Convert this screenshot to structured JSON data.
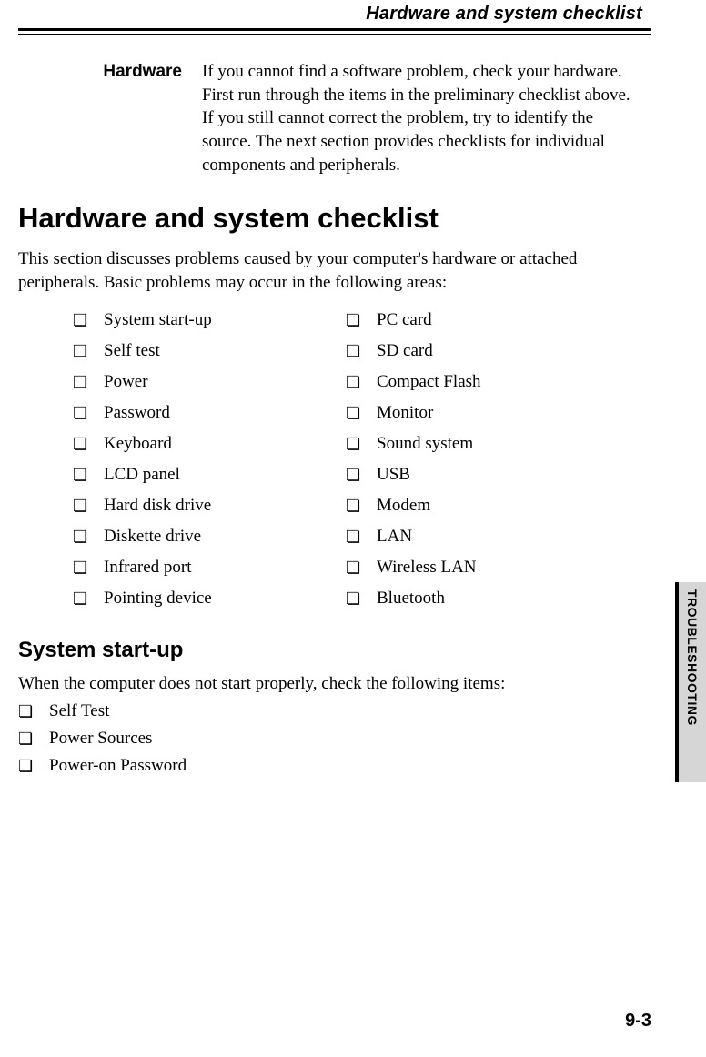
{
  "running_head": "Hardware and system checklist",
  "hardware_label": "Hardware",
  "hardware_text": "If you cannot find a software problem, check your hardware. First run through the items in the preliminary checklist above. If you still cannot correct the problem, try to identify the source. The next section provides checklists for individual components and peripherals.",
  "main_heading": "Hardware and system checklist",
  "intro_text": "This section discusses problems caused by your computer's hardware or attached peripherals. Basic problems may occur in the following areas:",
  "checklist_left": [
    "System start-up",
    "Self test",
    "Power",
    "Password",
    "Keyboard",
    "LCD panel",
    "Hard disk drive",
    "Diskette drive",
    "Infrared port",
    "Pointing device"
  ],
  "checklist_right": [
    "PC card",
    "SD card",
    "Compact Flash",
    "Monitor",
    "Sound system",
    "USB",
    "Modem",
    "LAN",
    "Wireless LAN",
    "Bluetooth"
  ],
  "sub_heading": "System  start-up",
  "sub_intro": "When the computer does not start properly, check the following items:",
  "sub_list": [
    "Self Test",
    "Power Sources",
    "Power-on Password"
  ],
  "side_tab": "TROUBLESHOOTING",
  "page_number": "9-3",
  "glyph_checkbox": "❏"
}
